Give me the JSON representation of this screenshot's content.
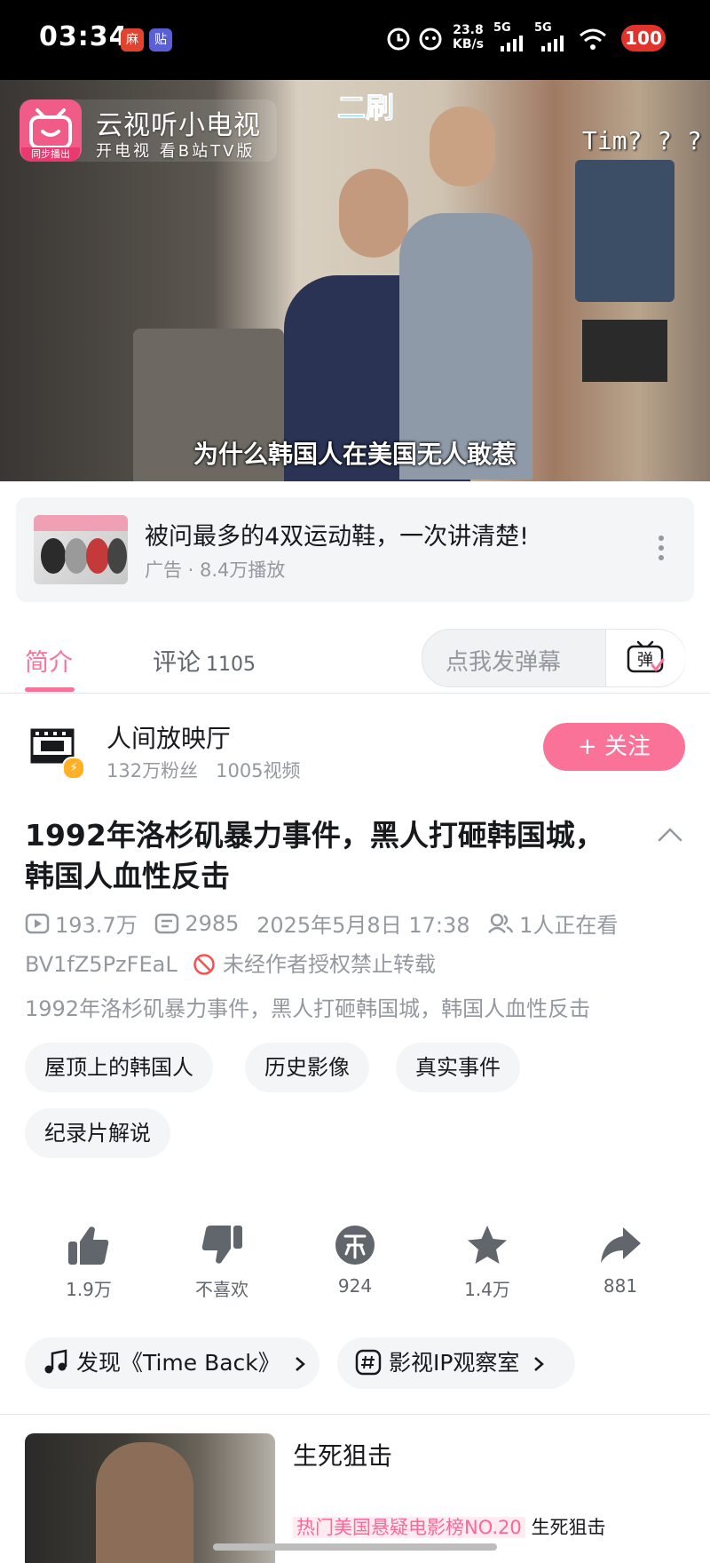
{
  "status_bar": {
    "time": "03:34",
    "net_speed": "23.8",
    "net_unit": "KB/s",
    "sim1": "5G",
    "sim2": "5G",
    "battery": "100"
  },
  "video": {
    "channel_title": "云视听小电视",
    "channel_subtitle": "开电视 看B站TV版",
    "channel_badge": "同步播出",
    "overlay_top": "二刷",
    "overlay_right": "Tim? ? ?",
    "subtitle": "为什么韩国人在美国无人敢惹"
  },
  "ad": {
    "title": "被问最多的4双运动鞋，一次讲清楚!",
    "meta": "广告 · 8.4万播放"
  },
  "tabs": {
    "intro": "简介",
    "comments": "评论",
    "comment_count": "1105",
    "danmaku_placeholder": "点我发弹幕",
    "danmaku_icon_text": "弹"
  },
  "author": {
    "name": "人间放映厅",
    "fans": "132万粉丝",
    "videos": "1005视频",
    "follow": "+ 关注"
  },
  "video_info": {
    "title": "1992年洛杉矶暴力事件，黑人打砸韩国城，韩国人血性反击",
    "plays": "193.7万",
    "danmaku_count": "2985",
    "date": "2025年5月8日 17:38",
    "watching": "1人正在看",
    "bvid": "BV1fZ5PzFEaL",
    "copyright": "未经作者授权禁止转载",
    "description": "1992年洛杉矶暴力事件，黑人打砸韩国城，韩国人血性反击",
    "tags": [
      "屋顶上的韩国人",
      "历史影像",
      "真实事件",
      "纪录片解说"
    ]
  },
  "actions": {
    "like": "1.9万",
    "dislike": "不喜欢",
    "coin": "924",
    "favorite": "1.4万",
    "share": "881"
  },
  "links": {
    "music": "发现《Time Back》",
    "topic": "影视IP观察室"
  },
  "recommend": {
    "title": "生死狙击",
    "hot_tag": "热门美国悬疑电影榜NO.20",
    "sub": "生死狙击"
  },
  "colors": {
    "accent": "#fb7299",
    "text_primary": "#18191c",
    "text_secondary": "#9499a0"
  }
}
